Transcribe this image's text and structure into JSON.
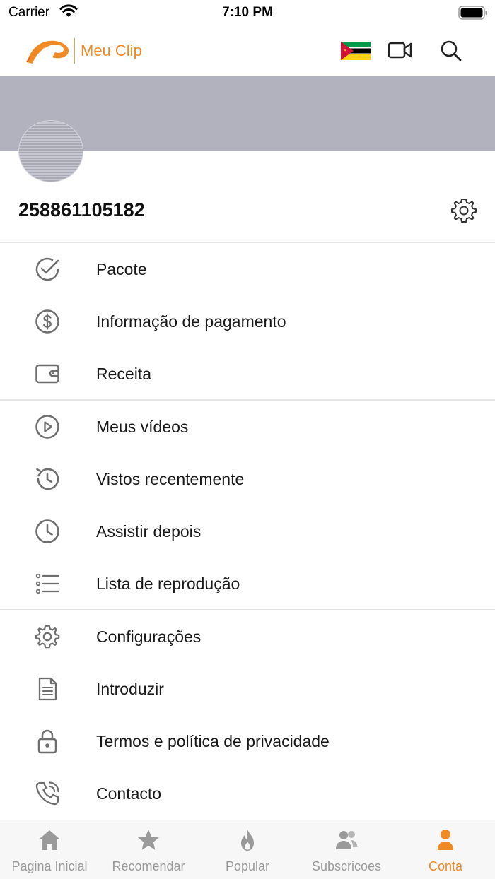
{
  "status_bar": {
    "carrier": "Carrier",
    "time": "7:10 PM"
  },
  "header": {
    "title": "Meu Clip",
    "logo_text": "Meu Clip",
    "brand_color": "#f08a24",
    "icons": [
      "mozambique-flag-icon",
      "video-camera-icon",
      "search-icon"
    ]
  },
  "profile": {
    "username": "258861105182"
  },
  "menu": {
    "section1": [
      {
        "label": "Pacote",
        "icon": "check-circle-icon"
      },
      {
        "label": "Informação de pagamento",
        "icon": "dollar-circle-icon"
      },
      {
        "label": "Receita",
        "icon": "wallet-icon"
      }
    ],
    "section2": [
      {
        "label": "Meus vídeos",
        "icon": "play-circle-icon"
      },
      {
        "label": "Vistos recentemente",
        "icon": "history-icon"
      },
      {
        "label": "Assistir depois",
        "icon": "clock-icon"
      },
      {
        "label": "Lista de reprodução",
        "icon": "list-icon"
      }
    ],
    "section3": [
      {
        "label": "Configurações",
        "icon": "gear-icon"
      },
      {
        "label": "Introduzir",
        "icon": "document-icon"
      },
      {
        "label": "Termos e política de privacidade",
        "icon": "lock-icon"
      },
      {
        "label": "Contacto",
        "icon": "phone-icon"
      }
    ]
  },
  "tabs": [
    {
      "label": "Pagina Inicial",
      "icon": "home-icon",
      "active": false
    },
    {
      "label": "Recomendar",
      "icon": "star-icon",
      "active": false
    },
    {
      "label": "Popular",
      "icon": "fire-icon",
      "active": false
    },
    {
      "label": "Subscricoes",
      "icon": "users-icon",
      "active": false
    },
    {
      "label": "Conta",
      "icon": "person-icon",
      "active": true
    }
  ],
  "colors": {
    "accent": "#f08a24",
    "icon_gray": "#6e6e6e",
    "tab_inactive": "#9a9a9a",
    "cover": "#b2b2be"
  }
}
